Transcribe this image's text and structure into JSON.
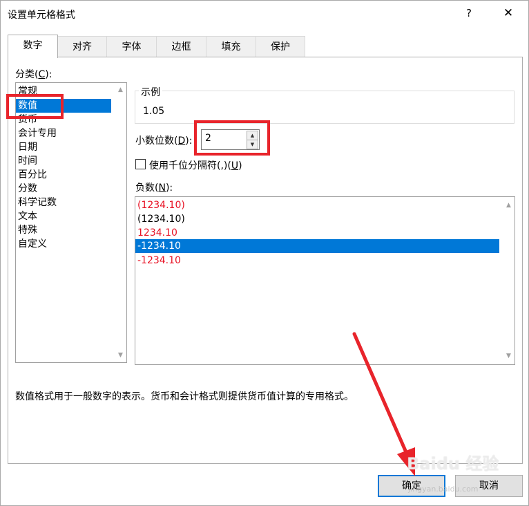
{
  "dialog": {
    "title": "设置单元格格式",
    "help_label": "?",
    "close_label": "✕"
  },
  "tabs": [
    {
      "label": "数字"
    },
    {
      "label": "对齐"
    },
    {
      "label": "字体"
    },
    {
      "label": "边框"
    },
    {
      "label": "填充"
    },
    {
      "label": "保护"
    }
  ],
  "category": {
    "label_text": "分类(",
    "label_key": "C",
    "label_tail": "):",
    "items": [
      "常规",
      "数值",
      "货币",
      "会计专用",
      "日期",
      "时间",
      "百分比",
      "分数",
      "科学记数",
      "文本",
      "特殊",
      "自定义"
    ],
    "selected": "数值"
  },
  "sample": {
    "label": "示例",
    "value": "1.05"
  },
  "decimals": {
    "label_text": "小数位数(",
    "label_key": "D",
    "label_tail": "):",
    "value": "2"
  },
  "thousands": {
    "label_text": "使用千位分隔符(,)(",
    "label_key": "U",
    "label_tail": ")",
    "checked": false
  },
  "negative": {
    "label_text": "负数(",
    "label_key": "N",
    "label_tail": "):",
    "items": [
      "(1234.10)",
      "(1234.10)",
      "1234.10",
      "-1234.10",
      "-1234.10"
    ],
    "selected_index": 3
  },
  "description": "数值格式用于一般数字的表示。货币和会计格式则提供货币值计算的专用格式。",
  "buttons": {
    "ok": "确定",
    "cancel": "取消"
  },
  "watermark": {
    "brand": "Baidu 经验",
    "url": "jingyan.baidu.com"
  },
  "colors": {
    "selection": "#0078d7",
    "negative_red": "#e81123",
    "annotation_red": "#e8242b"
  }
}
